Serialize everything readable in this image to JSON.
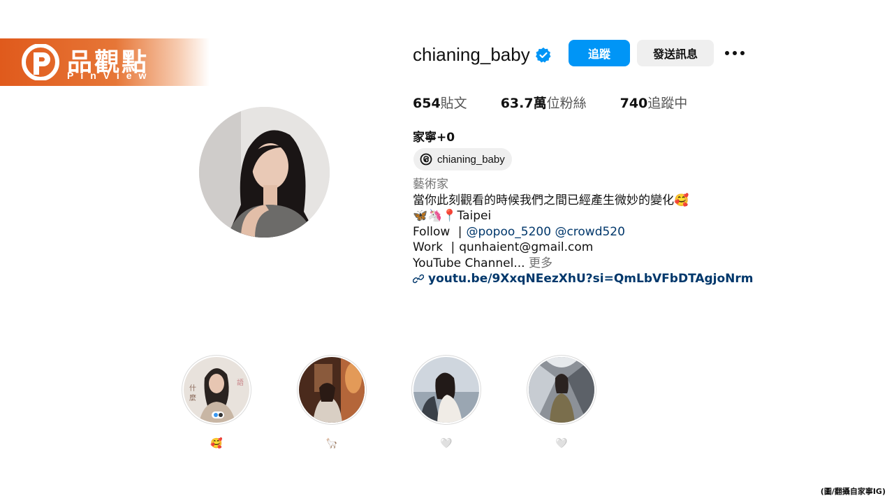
{
  "brand": {
    "name": "品觀點",
    "sub": "PinView"
  },
  "profile": {
    "username": "chianing_baby",
    "follow_label": "追蹤",
    "message_label": "發送訊息",
    "stats": [
      {
        "value": "654",
        "label": "貼文"
      },
      {
        "value": "63.7萬",
        "label": "位粉絲"
      },
      {
        "value": "740",
        "label": "追蹤中"
      }
    ],
    "full_name": "家寧+0",
    "threads_handle": "chianing_baby",
    "bio": {
      "category": "藝術家",
      "line1": "當你此刻觀看的時候我們之間已經產生微妙的變化🥰",
      "line2": "🦋🦄📍Taipei",
      "follow_prefix": "Follow",
      "follow_sep": "|",
      "mention1": "@popoo_5200",
      "mention2": "@crowd520",
      "work_prefix": "Work",
      "work_sep": "|",
      "work_email": "qunhaient@gmail.com",
      "youtube_text": "YouTube Channel...",
      "more_label": "更多",
      "link": "youtu.be/9XxqNEezXhU?si=QmLbVFbDTAgjoNrm"
    }
  },
  "highlights": [
    {
      "label": "🥰"
    },
    {
      "label": "🦙"
    },
    {
      "label": "🤍"
    },
    {
      "label": "🤍"
    }
  ],
  "credit": "(圖/翻攝自家寧IG)",
  "colors": {
    "follow_button": "#0095f6",
    "verified": "#0095f6",
    "brand": "#e05a1c",
    "link": "#00376b"
  }
}
